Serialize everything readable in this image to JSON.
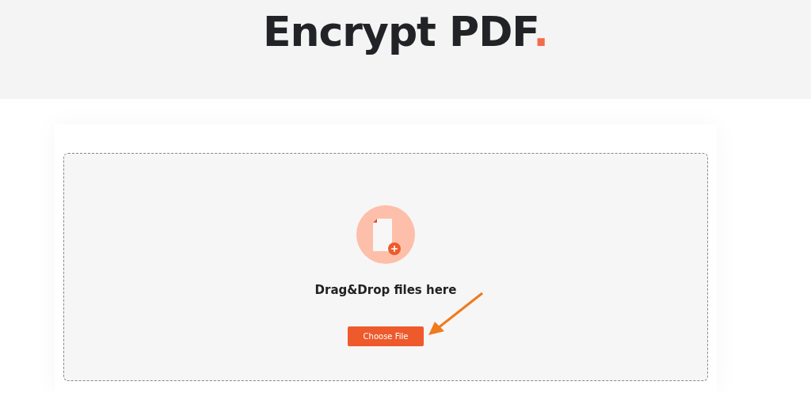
{
  "header": {
    "title": "Encrypt PDF",
    "title_mark": "."
  },
  "dropzone": {
    "prompt": "Drag&Drop files here",
    "button": "Choose File"
  }
}
